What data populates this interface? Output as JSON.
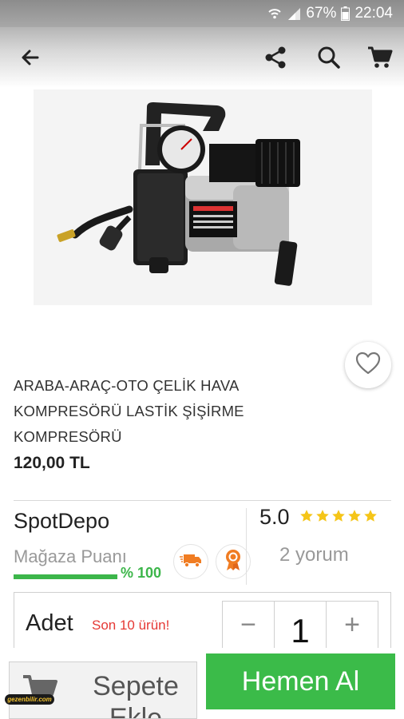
{
  "status_bar": {
    "battery": "67%",
    "time": "22:04",
    "icons": [
      "wifi-icon",
      "signal-icon",
      "battery-icon"
    ]
  },
  "toolbar": {
    "icons": [
      "back-arrow-icon",
      "share-icon",
      "search-icon",
      "cart-icon"
    ]
  },
  "product": {
    "title_lines": [
      "ARABA-ARAÇ-OTO ÇELİK HAVA",
      "KOMPRESÖRÜ LASTİK ŞİŞİRME",
      "KOMPRESÖRÜ"
    ],
    "price": "120,00 TL",
    "image": "air-compressor-image",
    "wishlist_icon": "heart-outline-icon"
  },
  "seller": {
    "name": "SpotDepo",
    "store_score_label": "Mağaza Puanı",
    "store_score": "% 100",
    "store_score_fraction": 1.0,
    "badges": [
      "fast-shipping-icon",
      "award-ribbon-icon"
    ]
  },
  "rating": {
    "value": "5.0",
    "stars": 5,
    "reviews": "2 yorum"
  },
  "quantity": {
    "label": "Adet",
    "stock_note": "Son 10 ürün!",
    "minus": "−",
    "value": "1",
    "plus": "+"
  },
  "actions": {
    "add_to_cart_line1": "Sepete",
    "add_to_cart_line2": "Ekle",
    "buy_now": "Hemen Al"
  },
  "watermark": "gezenbilir.com",
  "colors": {
    "accent_green": "#3bbb49",
    "star": "#f5c518",
    "stock_red": "#e53935",
    "badge_orange": "#f07c22"
  }
}
